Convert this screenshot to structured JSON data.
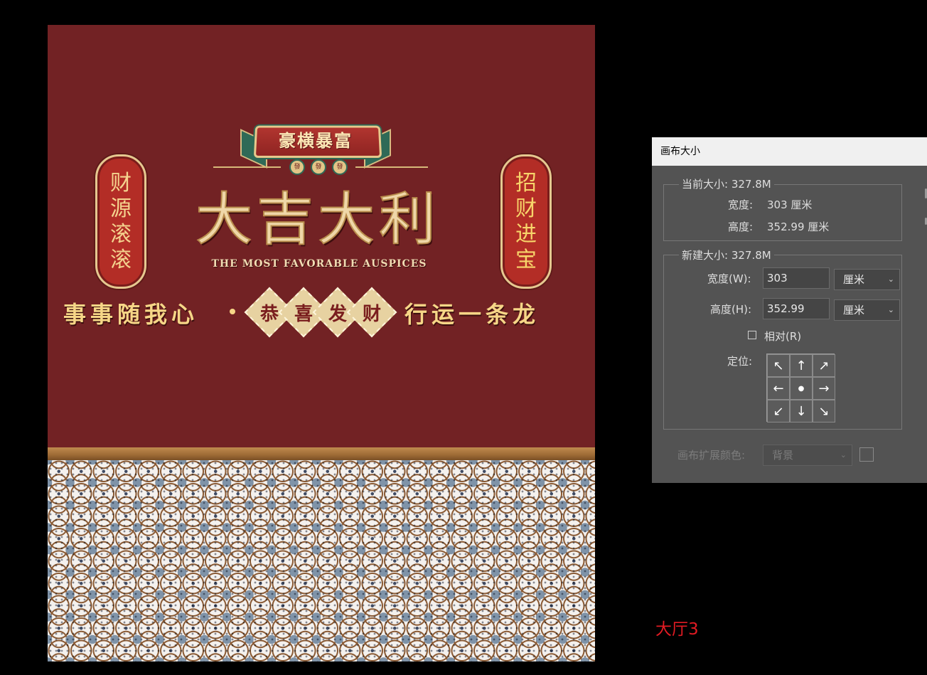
{
  "artwork": {
    "ribbon_text": "豪横暴富",
    "medallion_chars": [
      "發",
      "發",
      "發"
    ],
    "main_title": "大吉大利",
    "subtitle": "THE MOST FAVORABLE AUSPICES",
    "left_pill": [
      "财",
      "源",
      "滚",
      "滚"
    ],
    "right_pill": [
      "招",
      "财",
      "进",
      "宝"
    ],
    "slogan_left": "事事随我心",
    "slogan_center": [
      "恭",
      "喜",
      "发",
      "财"
    ],
    "slogan_right": "行运一条龙",
    "colors": {
      "background": "#722224",
      "gold": "#f6d687",
      "band": "#9d6a35",
      "pattern_blue": "#7f93a8"
    }
  },
  "dialog": {
    "title": "画布大小",
    "current": {
      "legend": "当前大小: 327.8M",
      "width_label": "宽度:",
      "width_value": "303 厘米",
      "height_label": "高度:",
      "height_value": "352.99 厘米"
    },
    "new": {
      "legend": "新建大小: 327.8M",
      "width_label": "宽度(W):",
      "width_value": "303",
      "width_unit": "厘米",
      "height_label": "高度(H):",
      "height_value": "352.99",
      "height_unit": "厘米",
      "relative_label": "相对(R)",
      "anchor_label": "定位:",
      "anchor_arrows": [
        "↖",
        "↑",
        "↗",
        "←",
        "●",
        "→",
        "↙",
        "↓",
        "↘"
      ]
    },
    "extension_label": "画布扩展颜色:",
    "extension_value": "背景"
  },
  "hall_label": "大厅3"
}
